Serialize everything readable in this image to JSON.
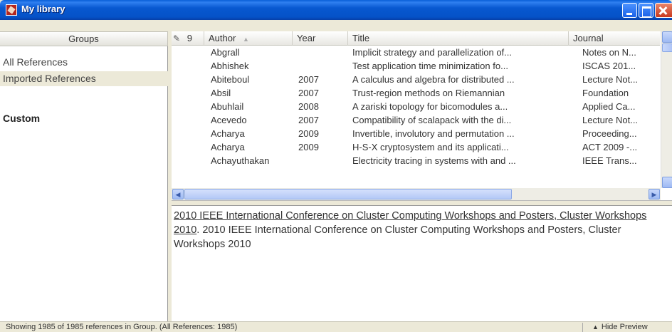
{
  "window": {
    "title": "My library"
  },
  "groups": {
    "header": "Groups",
    "items": [
      {
        "label": "All References"
      },
      {
        "label": "Imported References"
      }
    ],
    "custom_label": "Custom"
  },
  "table": {
    "columns": {
      "icons": "9",
      "author": "Author",
      "year": "Year",
      "title": "Title",
      "journal": "Journal"
    },
    "sort": "ascending",
    "rows": [
      {
        "author": "Abgrall",
        "year": "",
        "title": "Implicit strategy and parallelization of...",
        "journal": "Notes on N..."
      },
      {
        "author": "Abhishek",
        "year": "",
        "title": "Test application time minimization fo...",
        "journal": "ISCAS 201..."
      },
      {
        "author": "Abiteboul",
        "year": "2007",
        "title": "A calculus and algebra for distributed ...",
        "journal": "Lecture Not..."
      },
      {
        "author": "Absil",
        "year": "2007",
        "title": "Trust-region methods on Riemannian",
        "journal": "Foundation"
      },
      {
        "author": "Abuhlail",
        "year": "2008",
        "title": "A zariski topology for bicomodules a...",
        "journal": "Applied Ca..."
      },
      {
        "author": "Acevedo",
        "year": "2007",
        "title": "Compatibility of scalapack with the di...",
        "journal": "Lecture Not..."
      },
      {
        "author": "Acharya",
        "year": "2009",
        "title": "Invertible, involutory and permutation ...",
        "journal": "Proceeding..."
      },
      {
        "author": "Acharya",
        "year": "2009",
        "title": "H-S-X cryptosystem and its applicati...",
        "journal": "ACT 2009 -..."
      },
      {
        "author": "Achayuthakan",
        "year": "",
        "title": "Electricity tracing in systems with and ...",
        "journal": "IEEE Trans..."
      }
    ]
  },
  "preview": {
    "link_text": "2010 IEEE International Conference on Cluster Computing Workshops and Posters, Cluster Workshops 2010",
    "rest_text": ". 2010 IEEE International Conference on Cluster Computing Workshops and Posters, Cluster Workshops 2010"
  },
  "status": {
    "text": "Showing 1985 of 1985 references in Group. (All References: 1985)",
    "hide_preview": "Hide Preview"
  }
}
